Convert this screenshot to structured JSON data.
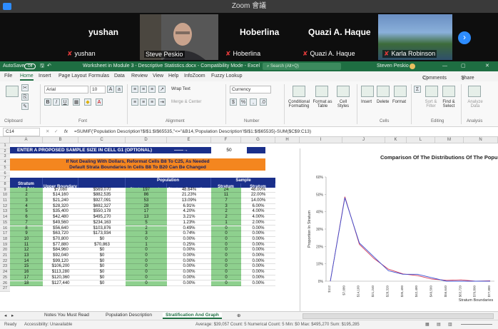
{
  "zoom": {
    "title": "Zoom 會議",
    "participants": [
      {
        "name": "yushan",
        "caption": "yushan",
        "muted": true
      },
      {
        "name": "",
        "caption": "Steve Peskio",
        "muted": false
      },
      {
        "name": "Hoberlina",
        "caption": "Hoberlina",
        "muted": true
      },
      {
        "name": "Quazi A. Haque",
        "caption": "Quazi A. Haque",
        "muted": true
      },
      {
        "name": "",
        "caption": "Karla Robinson",
        "muted": true
      }
    ],
    "next_icon": "chevron-right-icon"
  },
  "excel": {
    "autosave": "AutoSave",
    "autosave_state": "Off",
    "doc_title": "Worksheet in Module 3 - Descriptive Statistics.docx - Compatibility Mode - Excel",
    "search_placeholder": "Search (Alt+Q)",
    "user": "Steven Peskio",
    "tabs": [
      "File",
      "Home",
      "Insert",
      "Page Layout",
      "Formulas",
      "Data",
      "Review",
      "View",
      "Help",
      "InfoZoom",
      "Fuzzy Lookup"
    ],
    "active_tab": "Home",
    "comments_label": "Comments",
    "share_label": "Share",
    "ribbon": {
      "font_name": "Arial",
      "font_size": "10",
      "wrap_text": "Wrap Text",
      "merge_center": "Merge & Center",
      "number_format": "Currency",
      "conditional": "Conditional Formatting",
      "format_table": "Format as Table",
      "cell_styles": "Cell Styles",
      "insert": "Insert",
      "delete": "Delete",
      "format": "Format",
      "sort_filter": "Sort & Filter",
      "find_select": "Find & Select",
      "analyze": "Analyze Data",
      "groups": [
        "Clipboard",
        "Font",
        "Alignment",
        "Number",
        "Cells",
        "Editing",
        "Analysis"
      ]
    },
    "name_box": "C14",
    "formula": "=SUMIF('Population Description'!$I$1:$I$65535,\"<=\"&B14,'Population Description'!$I$1:$I$65535)-SUM($C$9:C13)",
    "columns": [
      "A",
      "B",
      "C",
      "D",
      "E",
      "F",
      "G",
      "H",
      "I",
      "J",
      "K",
      "L",
      "M",
      "N"
    ],
    "row_numbers": [
      "1",
      "2",
      "3",
      "4",
      "5",
      "6",
      "7",
      "8",
      "9",
      "10",
      "11",
      "12",
      "13",
      "14",
      "15",
      "16",
      "17",
      "18",
      "19",
      "20",
      "21",
      "22",
      "23",
      "24",
      "25",
      "26",
      "27"
    ],
    "banner1": "ENTER A PROPOSED SAMPLE SIZE IN CELL G1 (OPTIONAL)",
    "banner1_value": "50",
    "banner2_line1": "If Not Dealing With Dollars, Reformat Cells B8 To C25, As Needed",
    "banner2_line2": "Default Strata Boundaries In Cells B8 To B20 Can Be Changed",
    "headers": {
      "stratum_number": "Stratum Number",
      "upper_boundary": "Upper Boundary",
      "stratum_sum": "Stratum Sum",
      "population_group": "Population",
      "pop_counts": "Stratum Counts",
      "pop_props": "Stratum Proportions",
      "sample_group": "Sample",
      "sample_counts": "Stratum Counts",
      "sample_props": "Stratum Proportions"
    },
    "rows": [
      {
        "n": "1",
        "ub": "$7,080",
        "sum": "$569,070",
        "pc": "197",
        "pp": "48.64%",
        "sc": "24",
        "sp": "48.00%"
      },
      {
        "n": "2",
        "ub": "$14,160",
        "sum": "$882,535",
        "pc": "86",
        "pp": "21.23%",
        "sc": "11",
        "sp": "22.00%"
      },
      {
        "n": "3",
        "ub": "$21,240",
        "sum": "$927,091",
        "pc": "53",
        "pp": "13.09%",
        "sc": "7",
        "sp": "14.00%"
      },
      {
        "n": "4",
        "ub": "$28,320",
        "sum": "$692,327",
        "pc": "28",
        "pp": "6.91%",
        "sc": "3",
        "sp": "6.00%"
      },
      {
        "n": "5",
        "ub": "$35,400",
        "sum": "$550,178",
        "pc": "17",
        "pp": "4.20%",
        "sc": "2",
        "sp": "4.00%"
      },
      {
        "n": "6",
        "ub": "$42,480",
        "sum": "$495,270",
        "pc": "13",
        "pp": "3.21%",
        "sc": "2",
        "sp": "4.00%"
      },
      {
        "n": "7",
        "ub": "$49,560",
        "sum": "$234,163",
        "pc": "5",
        "pp": "1.23%",
        "sc": "1",
        "sp": "2.00%"
      },
      {
        "n": "8",
        "ub": "$56,640",
        "sum": "$103,876",
        "pc": "2",
        "pp": "0.49%",
        "sc": "0",
        "sp": "0.00%"
      },
      {
        "n": "9",
        "ub": "$63,720",
        "sum": "$173,934",
        "pc": "3",
        "pp": "0.74%",
        "sc": "0",
        "sp": "0.00%"
      },
      {
        "n": "10",
        "ub": "$70,800",
        "sum": "$0",
        "pc": "0",
        "pp": "0.00%",
        "sc": "0",
        "sp": "0.00%"
      },
      {
        "n": "11",
        "ub": "$77,880",
        "sum": "$70,863",
        "pc": "1",
        "pp": "0.25%",
        "sc": "0",
        "sp": "0.00%"
      },
      {
        "n": "12",
        "ub": "$84,960",
        "sum": "$0",
        "pc": "0",
        "pp": "0.00%",
        "sc": "0",
        "sp": "0.00%"
      },
      {
        "n": "13",
        "ub": "$92,040",
        "sum": "$0",
        "pc": "0",
        "pp": "0.00%",
        "sc": "0",
        "sp": "0.00%"
      },
      {
        "n": "14",
        "ub": "$99,120",
        "sum": "$0",
        "pc": "0",
        "pp": "0.00%",
        "sc": "0",
        "sp": "0.00%"
      },
      {
        "n": "15",
        "ub": "$106,200",
        "sum": "$0",
        "pc": "0",
        "pp": "0.00%",
        "sc": "0",
        "sp": "0.00%"
      },
      {
        "n": "16",
        "ub": "$113,280",
        "sum": "$0",
        "pc": "0",
        "pp": "0.00%",
        "sc": "0",
        "sp": "0.00%"
      },
      {
        "n": "17",
        "ub": "$120,360",
        "sum": "$0",
        "pc": "0",
        "pp": "0.00%",
        "sc": "0",
        "sp": "0.00%"
      },
      {
        "n": "18",
        "ub": "$127,440",
        "sum": "$0",
        "pc": "0",
        "pp": "0.00%",
        "sc": "0",
        "sp": "0.00%"
      }
    ],
    "sheet_tabs": [
      "Notes You Must Read",
      "Population Description",
      "Stratification And Graph"
    ],
    "active_sheet": "Stratification And Graph",
    "status": {
      "ready": "Ready",
      "accessibility": "Accessibility: Unavailable",
      "summary": "Average: $39,057   Count: 5   Numerical Count: 5   Min: $0   Max: $495,270   Sum: $195,285"
    },
    "colors": {
      "excel_green": "#1e6e42",
      "header_navy": "#1a2f8a",
      "cell_green": "#8ed08e",
      "banner_orange": "#f4861f",
      "pop_line": "#d23a5a",
      "sample_line": "#3a4fd2"
    }
  },
  "chart_data": {
    "type": "line",
    "title": "Comparison Of The Distributions Of The Popu",
    "ylabel": "Proportion In Stratum",
    "xlabel": "Stratum Boundaries",
    "ylim": [
      0,
      0.6
    ],
    "y_ticks": [
      "0%",
      "10%",
      "20%",
      "30%",
      "40%",
      "50%",
      "60%"
    ],
    "categories": [
      "$112",
      "$7,080",
      "$14,160",
      "$21,240",
      "$28,320",
      "$35,400",
      "$42,480",
      "$49,560",
      "$56,640",
      "$63,720",
      "$70,800",
      "$77,880"
    ],
    "series": [
      {
        "values": [
          0.0,
          0.4864,
          0.2123,
          0.1309,
          0.0691,
          0.042,
          0.0321,
          0.0123,
          0.0049,
          0.0074,
          0.0,
          0.0025
        ]
      },
      {
        "values": [
          0.0,
          0.48,
          0.22,
          0.14,
          0.06,
          0.04,
          0.04,
          0.02,
          0.0,
          0.0,
          0.0,
          0.0
        ]
      }
    ]
  }
}
